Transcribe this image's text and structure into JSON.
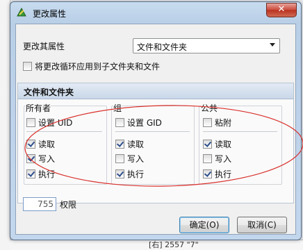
{
  "dialog": {
    "title": "更改属性",
    "close_label": "✕",
    "change_label": "更改其属性",
    "target_selected": "文件和文件夹",
    "recursive_label": "将更改循环应用到子文件夹和文件",
    "recursive_checked": false
  },
  "section": {
    "title": "文件和文件夹",
    "groups": [
      {
        "heading": "所有者",
        "special": "设置 UID",
        "special_checked": false,
        "read": "读取",
        "read_checked": true,
        "write": "写入",
        "write_checked": true,
        "exec": "执行",
        "exec_checked": true
      },
      {
        "heading": "组",
        "special": "设置 GID",
        "special_checked": false,
        "read": "读取",
        "read_checked": true,
        "write": "写入",
        "write_checked": false,
        "exec": "执行",
        "exec_checked": true
      },
      {
        "heading": "公共",
        "special": "粘附",
        "special_checked": false,
        "read": "读取",
        "read_checked": true,
        "write": "写入",
        "write_checked": false,
        "exec": "执行",
        "exec_checked": true
      }
    ],
    "permission_value": "755",
    "permission_label": "权限"
  },
  "buttons": {
    "ok": "确定(O)",
    "cancel": "取消(C)"
  },
  "background": {
    "bottom_text": "[右] 2557 \"7\""
  },
  "colors": {
    "annotation": "#d9302c",
    "titlebar": "#b9cfe6"
  }
}
